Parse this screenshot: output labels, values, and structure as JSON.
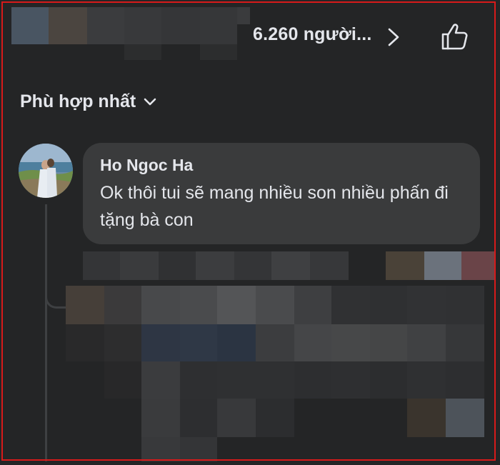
{
  "header": {
    "reaction_count": "6.260 người...",
    "icons": [
      "chevron-right-icon",
      "thumbs-up-icon"
    ]
  },
  "sort": {
    "label": "Phù hợp nhất",
    "icon": "chevron-down-icon"
  },
  "comment": {
    "author": "Ho Ngoc Ha",
    "text": "Ok thôi tui sẽ mang nhiều son nhiều phấn đi tặng bà con"
  },
  "colors": {
    "background": "#242526",
    "bubble": "#3a3b3c",
    "text": "#e4e6eb",
    "frame": "#d81a1a"
  }
}
